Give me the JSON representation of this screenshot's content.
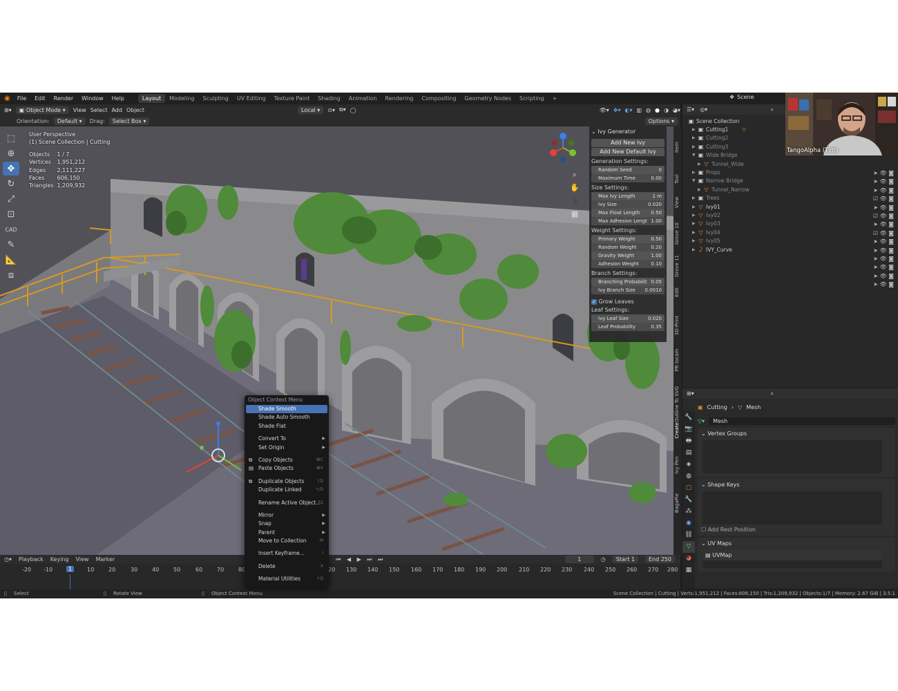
{
  "menu": [
    "File",
    "Edit",
    "Render",
    "Window",
    "Help"
  ],
  "workspaces": [
    "Layout",
    "Modeling",
    "Sculpting",
    "UV Editing",
    "Texture Paint",
    "Shading",
    "Animation",
    "Rendering",
    "Compositing",
    "Geometry Nodes",
    "Scripting",
    "+"
  ],
  "scene_name": "Scene",
  "header": {
    "mode": "Object Mode",
    "view": "View",
    "select": "Select",
    "add": "Add",
    "object": "Object",
    "transform": "Local",
    "options": "Options"
  },
  "tool_settings": {
    "orientation_label": "Orientation:",
    "orientation": "Default",
    "drag_label": "Drag:",
    "drag": "Select Box"
  },
  "viewport": {
    "title": "User Perspective",
    "collection": "(1) Scene Collection | Cutting",
    "stats": [
      {
        "k": "Objects",
        "v": "1 / 7"
      },
      {
        "k": "Vertices",
        "v": "1,951,212"
      },
      {
        "k": "Edges",
        "v": "2,111,227"
      },
      {
        "k": "Faces",
        "v": "606,150"
      },
      {
        "k": "Triangles",
        "v": "1,209,932"
      }
    ]
  },
  "ivy": {
    "title": "Ivy Generator",
    "add_new": "Add New Ivy",
    "add_default": "Add New Default Ivy",
    "gen_title": "Generation Settings:",
    "gen": [
      {
        "k": "Random Seed",
        "v": "0"
      },
      {
        "k": "Maximum Time",
        "v": "0.00"
      }
    ],
    "size_title": "Size Settings:",
    "size": [
      {
        "k": "Max Ivy Length",
        "v": "1 m"
      },
      {
        "k": "Ivy Size",
        "v": "0.020"
      },
      {
        "k": "Max Float Length",
        "v": "0.50"
      },
      {
        "k": "Max Adhesion Lengt",
        "v": "1.00"
      }
    ],
    "weight_title": "Weight Settings:",
    "weight": [
      {
        "k": "Primary Weight",
        "v": "0.50"
      },
      {
        "k": "Random Weight",
        "v": "0.20"
      },
      {
        "k": "Gravity Weight",
        "v": "1.00"
      },
      {
        "k": "Adhesion Weight",
        "v": "0.10"
      }
    ],
    "branch_title": "Branch Settings:",
    "branch": [
      {
        "k": "Branching Probabilit",
        "v": "0.05"
      },
      {
        "k": "Ivy Branch Size",
        "v": "0.0010"
      }
    ],
    "grow_leaves": "Grow Leaves",
    "leaf_title": "Leaf Settings:",
    "leaf": [
      {
        "k": "Ivy Leaf Size",
        "v": "0.020"
      },
      {
        "k": "Leaf Probability",
        "v": "0.35"
      }
    ]
  },
  "side_tabs": [
    "Item",
    "Tool",
    "View",
    "Grove 10",
    "Grove 11",
    "Edit",
    "3D-Print",
    "PR Iocam",
    "Outline To SVG",
    "Create",
    "Ivy Pen",
    "BagaPie"
  ],
  "outliner": {
    "root": "Scene Collection",
    "items": [
      {
        "name": "Cutting1",
        "dim": false
      },
      {
        "name": "Cutting2",
        "dim": true
      },
      {
        "name": "Cutting3",
        "dim": true
      },
      {
        "name": "Wide Bridge",
        "dim": true
      },
      {
        "name": "Tunnel_Wide",
        "dim": true
      },
      {
        "name": "Props",
        "dim": true
      },
      {
        "name": "Narrow Bridge",
        "dim": true
      },
      {
        "name": "Tunnel_Narrow",
        "dim": true
      },
      {
        "name": "Trees",
        "dim": true
      },
      {
        "name": "Ivy01",
        "dim": false
      },
      {
        "name": "Ivy02",
        "dim": true
      },
      {
        "name": "Ivy03",
        "dim": true
      },
      {
        "name": "Ivy04",
        "dim": true
      },
      {
        "name": "Ivy05",
        "dim": true
      },
      {
        "name": "IVY_Curve",
        "dim": false
      }
    ]
  },
  "properties": {
    "breadcrumb_obj": "Cutting",
    "breadcrumb_data": "Mesh",
    "data_name": "Mesh",
    "vertex_groups": "Vertex Groups",
    "shape_keys": "Shape Keys",
    "add_rest": "Add Rest Position",
    "uv_maps": "UV Maps",
    "uv_item": "UVMap"
  },
  "context_menu": {
    "title": "Object Context Menu",
    "items": [
      {
        "label": "Shade Smooth",
        "hl": true
      },
      {
        "label": "Shade Auto Smooth"
      },
      {
        "label": "Shade Flat"
      },
      {
        "sep": true
      },
      {
        "label": "Convert To",
        "arrow": true
      },
      {
        "label": "Set Origin",
        "arrow": true
      },
      {
        "sep": true
      },
      {
        "label": "Copy Objects",
        "sc": "⌘C"
      },
      {
        "label": "Paste Objects",
        "sc": "⌘V"
      },
      {
        "sep": true
      },
      {
        "label": "Duplicate Objects",
        "sc": "⇧D"
      },
      {
        "label": "Duplicate Linked",
        "sc": "⌥D"
      },
      {
        "sep": true
      },
      {
        "label": "Rename Active Object...",
        "sc": "F2"
      },
      {
        "sep": true
      },
      {
        "label": "Mirror",
        "arrow": true
      },
      {
        "label": "Snap",
        "arrow": true
      },
      {
        "label": "Parent",
        "arrow": true
      },
      {
        "label": "Move to Collection",
        "sc": "M"
      },
      {
        "sep": true
      },
      {
        "label": "Insert Keyframe...",
        "sc": "I"
      },
      {
        "sep": true
      },
      {
        "label": "Delete",
        "sc": "X"
      },
      {
        "sep": true
      },
      {
        "label": "Material Utilities",
        "sc": "⇧Q"
      }
    ]
  },
  "timeline": {
    "playback": "Playback",
    "keying": "Keying",
    "view": "View",
    "marker": "Marker",
    "frame": "1",
    "start_label": "Start",
    "start": "1",
    "end_label": "End",
    "end": "250",
    "ticks": [
      "-20",
      "-10",
      "1",
      "10",
      "20",
      "30",
      "40",
      "50",
      "60",
      "70",
      "80",
      "120",
      "130",
      "140",
      "150",
      "160",
      "170",
      "180",
      "190",
      "200",
      "210",
      "220",
      "230",
      "240",
      "250",
      "260",
      "270",
      "280"
    ]
  },
  "status": {
    "select": "Select",
    "rotate": "Rotate View",
    "ctx": "Object Context Menu",
    "info": "Scene Collection | Cutting | Verts:1,951,212 | Faces:606,150 | Tris:1,209,932 | Objects:1/7 | Memory: 2.67 GiB | 3.5.1"
  },
  "webcam_name": "TangoAlpha (Tim)"
}
